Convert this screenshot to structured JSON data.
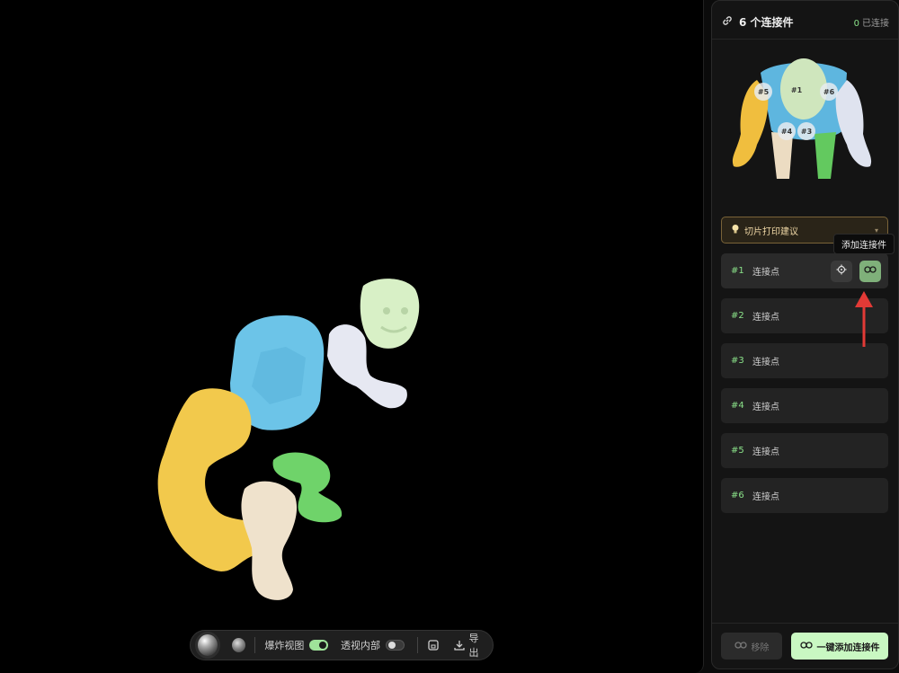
{
  "toolbar": {
    "explode_label": "爆炸视图",
    "explode_on": true,
    "xray_label": "透视内部",
    "xray_on": false,
    "export_label": "导出"
  },
  "panel": {
    "title": "6 个连接件",
    "connected_count": "0",
    "connected_label": "已连接",
    "preview_pins": [
      "#1",
      "#5",
      "#6",
      "#4",
      "#3"
    ],
    "suggest_label": "切片打印建议",
    "tooltip": "添加连接件",
    "rows": [
      {
        "idx": "#1",
        "label": "连接点"
      },
      {
        "idx": "#2",
        "label": "连接点"
      },
      {
        "idx": "#3",
        "label": "连接点"
      },
      {
        "idx": "#4",
        "label": "连接点"
      },
      {
        "idx": "#5",
        "label": "连接点"
      },
      {
        "idx": "#6",
        "label": "连接点"
      }
    ],
    "remove_label": "移除",
    "add_all_label": "一键添加连接件"
  },
  "colors": {
    "accent": "#8be38a",
    "part_head": "#d8f0c6",
    "part_torso": "#6cc4e8",
    "part_arm_left": "#f2c94c",
    "part_arm_right": "#e6e8f2",
    "part_leg_left": "#efe2cc",
    "part_leg_right": "#6fd36a"
  }
}
